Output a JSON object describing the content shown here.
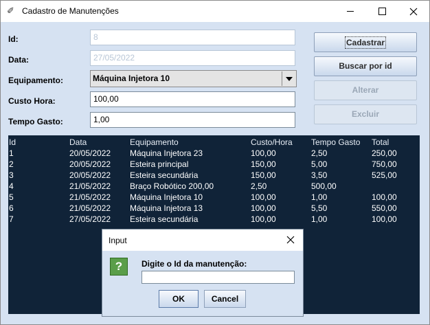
{
  "window": {
    "title": "Cadastro de Manutenções"
  },
  "form": {
    "id_label": "Id:",
    "id_value": "8",
    "data_label": "Data:",
    "data_value": "27/05/2022",
    "equipamento_label": "Equipamento:",
    "equipamento_value": "Máquina Injetora 10",
    "custo_label": "Custo Hora:",
    "custo_value": "100,00",
    "tempo_label": "Tempo Gasto:",
    "tempo_value": "1,00"
  },
  "buttons": {
    "cadastrar": "Cadastrar",
    "buscar": "Buscar por id",
    "alterar": "Alterar",
    "excluir": "Excluir"
  },
  "table": {
    "headers": [
      "Id",
      "Data",
      "Equipamento",
      "Custo/Hora",
      "Tempo Gasto",
      "Total"
    ],
    "rows": [
      [
        "1",
        "20/05/2022",
        "Máquina Injetora 23",
        "100,00",
        "2,50",
        "250,00"
      ],
      [
        "2",
        "20/05/2022",
        "Esteira principal",
        "150,00",
        "5,00",
        "750,00"
      ],
      [
        "3",
        "20/05/2022",
        "Esteira secundária",
        "150,00",
        "3,50",
        "525,00"
      ],
      [
        "4",
        "21/05/2022",
        "Braço Robótico 200,00",
        "2,50",
        "500,00",
        ""
      ],
      [
        "5",
        "21/05/2022",
        "Máquina Injetora 10",
        "100,00",
        "1,00",
        "100,00"
      ],
      [
        "6",
        "21/05/2022",
        "Máquina Injetora 13",
        "100,00",
        "5,50",
        "550,00"
      ],
      [
        "7",
        "27/05/2022",
        "Esteira secundária",
        "100,00",
        "1,00",
        "100,00"
      ]
    ]
  },
  "dialog": {
    "title": "Input",
    "icon": "question-icon",
    "message": "Digite o Id da manutenção:",
    "input_value": "",
    "ok": "OK",
    "cancel": "Cancel"
  },
  "colors": {
    "window_bg": "#d6e2f2",
    "table_bg": "#102338",
    "question_icon": "#5a9e4a"
  }
}
